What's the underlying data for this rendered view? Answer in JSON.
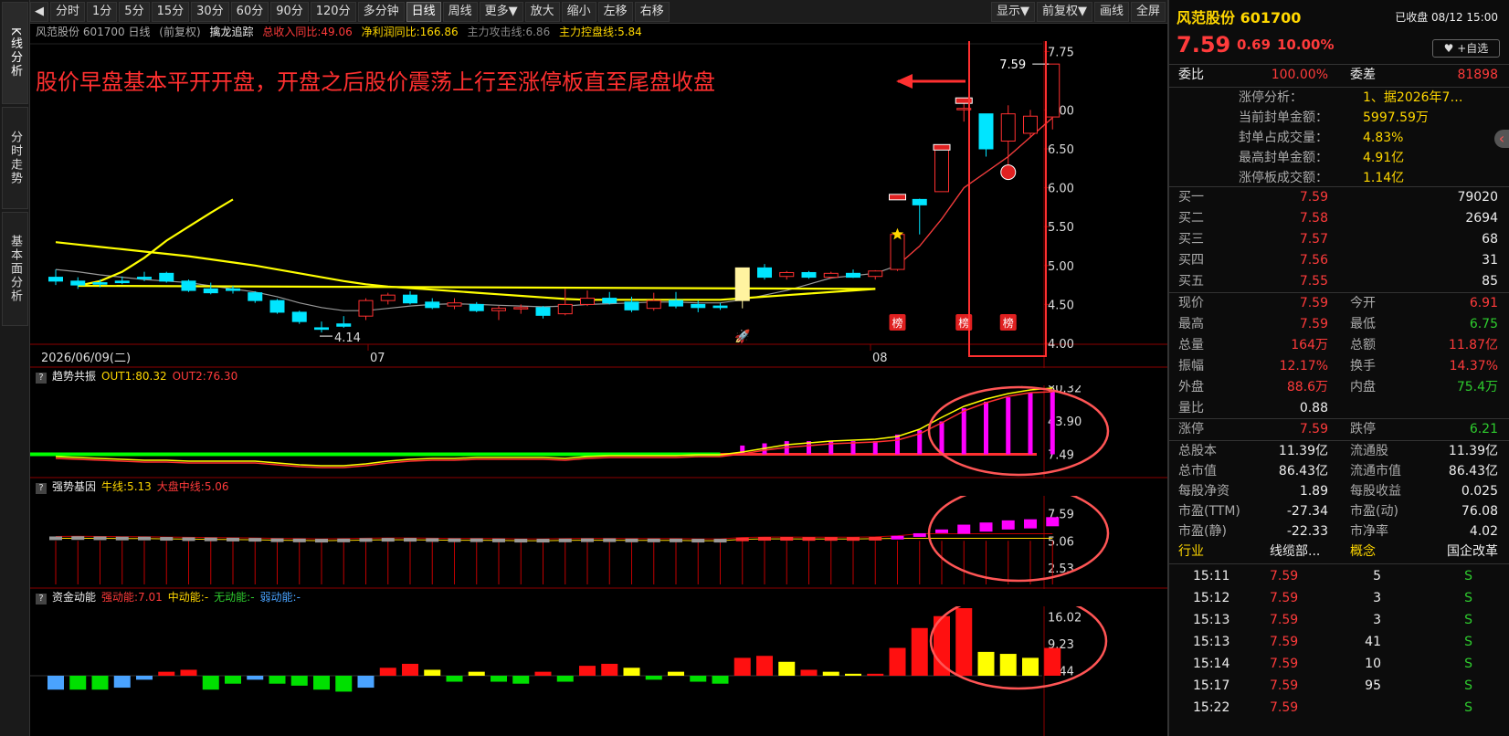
{
  "left_tabs": [
    "K线分析",
    "分时走势",
    "基本面分析"
  ],
  "toolbar": {
    "periods": [
      "分时",
      "1分",
      "5分",
      "15分",
      "30分",
      "60分",
      "90分",
      "120分",
      "多分钟",
      "日线",
      "周线",
      "更多▼",
      "放大",
      "缩小",
      "左移",
      "右移"
    ],
    "active": "日线",
    "right": [
      "显示▼",
      "前复权▼",
      "画线",
      "全屏"
    ]
  },
  "kline_header": {
    "name": "风范股份 601700 日线",
    "adj": "(前复权)",
    "indicator": "擒龙追踪",
    "rev": "总收入同比:49.06",
    "profit": "净利润同比:166.86",
    "attack": "主力攻击线:6.86",
    "control": "主力控盘线:5.84"
  },
  "annotation": "股价早盘基本平开开盘，开盘之后股价震荡上行至涨停板直至尾盘收盘",
  "price_axis": [
    "7.75",
    "7.00",
    "6.50",
    "6.00",
    "5.50",
    "5.00",
    "4.50",
    "4.00"
  ],
  "date_labels": [
    "2026/06/09(二)",
    "07",
    "08"
  ],
  "low_label": "4.14",
  "high_label": "7.59",
  "bang_label": "榜",
  "panel1": {
    "title": "趋势共振",
    "out1": "OUT1:80.32",
    "out2": "OUT2:76.30",
    "axis": [
      "80.32",
      "43.90",
      "7.49"
    ]
  },
  "panel2": {
    "title": "强势基因",
    "bull": "牛线:5.13",
    "mid": "大盘中线:5.06",
    "axis": [
      "7.59",
      "5.06",
      "2.53"
    ]
  },
  "panel3": {
    "title": "资金动能",
    "strong": "强动能:7.01",
    "medium": "中动能:-",
    "none": "无动能:-",
    "weak": "弱动能:-",
    "axis": [
      "16.02",
      "9.23",
      "2.44"
    ]
  },
  "colors": {
    "up": "#ff3030",
    "down": "#00e5ff",
    "ma_yellow": "#ffff00",
    "ma_grey": "#999999",
    "magenta": "#ff00ff",
    "green": "#00ff00"
  },
  "chart_data": {
    "type": "candlestick",
    "ylim": [
      4.0,
      7.85
    ],
    "candles": [
      [
        4.85,
        4.95,
        4.8,
        4.75
      ],
      [
        4.8,
        4.85,
        4.75,
        4.7
      ],
      [
        4.78,
        4.82,
        4.76,
        4.72
      ],
      [
        4.8,
        4.86,
        4.78,
        4.76
      ],
      [
        4.85,
        4.92,
        4.83,
        4.8
      ],
      [
        4.9,
        4.92,
        4.8,
        4.78
      ],
      [
        4.8,
        4.82,
        4.68,
        4.66
      ],
      [
        4.7,
        4.78,
        4.65,
        4.63
      ],
      [
        4.7,
        4.74,
        4.68,
        4.64
      ],
      [
        4.65,
        4.67,
        4.55,
        4.52
      ],
      [
        4.55,
        4.57,
        4.4,
        4.38
      ],
      [
        4.4,
        4.42,
        4.28,
        4.25
      ],
      [
        4.2,
        4.28,
        4.18,
        4.14
      ],
      [
        4.25,
        4.35,
        4.22,
        4.2
      ],
      [
        4.35,
        4.58,
        4.55,
        4.3
      ],
      [
        4.55,
        4.65,
        4.62,
        4.5
      ],
      [
        4.62,
        4.67,
        4.52,
        4.5
      ],
      [
        4.53,
        4.58,
        4.46,
        4.44
      ],
      [
        4.48,
        4.58,
        4.52,
        4.44
      ],
      [
        4.5,
        4.53,
        4.42,
        4.4
      ],
      [
        4.42,
        4.48,
        4.45,
        4.3
      ],
      [
        4.45,
        4.5,
        4.46,
        4.38
      ],
      [
        4.46,
        4.48,
        4.36,
        4.32
      ],
      [
        4.38,
        4.7,
        4.5,
        4.36
      ],
      [
        4.5,
        4.68,
        4.58,
        4.48
      ],
      [
        4.58,
        4.66,
        4.52,
        4.5
      ],
      [
        4.53,
        4.6,
        4.43,
        4.4
      ],
      [
        4.45,
        4.65,
        4.55,
        4.42
      ],
      [
        4.55,
        4.66,
        4.48,
        4.45
      ],
      [
        4.5,
        4.55,
        4.46,
        4.4
      ],
      [
        4.48,
        4.52,
        4.46,
        4.43
      ],
      [
        4.55,
        4.97,
        4.97,
        4.45
      ],
      [
        4.97,
        5.02,
        4.85,
        4.82
      ],
      [
        4.86,
        4.93,
        4.91,
        4.82
      ],
      [
        4.91,
        4.93,
        4.85,
        4.83
      ],
      [
        4.85,
        4.92,
        4.9,
        4.83
      ],
      [
        4.9,
        4.95,
        4.85,
        4.84
      ],
      [
        4.86,
        4.94,
        4.93,
        4.82
      ],
      [
        4.95,
        5.4,
        5.4,
        4.93
      ],
      [
        5.85,
        5.86,
        5.78,
        5.4
      ],
      [
        5.95,
        6.52,
        6.52,
        5.95
      ],
      [
        7.02,
        7.1,
        7.02,
        6.85
      ],
      [
        6.95,
        6.95,
        6.5,
        6.4
      ],
      [
        6.6,
        7.06,
        6.95,
        6.15
      ],
      [
        6.7,
        7.0,
        6.92,
        6.65
      ],
      [
        6.91,
        7.59,
        7.59,
        6.75
      ]
    ],
    "ma_yellow": [
      5.3,
      5.27,
      5.24,
      5.21,
      5.18,
      5.15,
      5.12,
      5.08,
      5.04,
      5.0,
      4.95,
      4.9,
      4.85,
      4.8,
      4.76,
      4.73,
      4.71,
      4.69,
      4.67,
      4.65,
      4.63,
      4.61,
      4.59,
      4.57,
      4.56,
      4.56,
      4.56,
      4.56,
      4.56,
      4.56,
      4.56,
      4.58,
      4.6,
      4.62,
      4.64,
      4.66,
      4.68,
      4.7,
      4.74,
      4.8,
      4.92,
      5.1,
      5.32,
      5.5,
      5.68,
      5.85
    ],
    "ma_grey": [
      4.95,
      4.92,
      4.88,
      4.85,
      4.82,
      4.8,
      4.78,
      4.74,
      4.7,
      4.66,
      4.6,
      4.52,
      4.46,
      4.42,
      4.42,
      4.45,
      4.48,
      4.5,
      4.51,
      4.5,
      4.49,
      4.48,
      4.47,
      4.48,
      4.5,
      4.51,
      4.52,
      4.53,
      4.53,
      4.52,
      4.52,
      4.56,
      4.62,
      4.68,
      4.76,
      4.84,
      4.87,
      4.9,
      5.0,
      5.25,
      5.6,
      6.0,
      6.2,
      6.4,
      6.65,
      6.9
    ],
    "p1_yellow": [
      5,
      4,
      3,
      2,
      1,
      1,
      0,
      0,
      0,
      0,
      -2,
      -4,
      -5,
      -5,
      -3,
      0,
      2,
      3,
      3,
      4,
      4,
      4,
      4,
      3,
      5,
      6,
      6,
      6,
      6,
      7,
      7,
      10,
      14,
      18,
      20,
      22,
      23,
      24,
      27,
      35,
      48,
      60,
      68,
      74,
      78,
      80
    ],
    "p1_red": [
      3,
      2,
      1,
      0,
      -1,
      -1,
      -2,
      -2,
      -2,
      -2,
      -4,
      -6,
      -7,
      -7,
      -5,
      -2,
      0,
      1,
      1,
      2,
      2,
      2,
      2,
      1,
      3,
      4,
      4,
      4,
      4,
      5,
      5,
      8,
      12,
      15,
      17,
      19,
      20,
      21,
      23,
      30,
      42,
      55,
      64,
      71,
      75,
      76
    ],
    "p1_bars": [
      0,
      0,
      0,
      0,
      0,
      0,
      0,
      0,
      0,
      0,
      0,
      0,
      0,
      0,
      0,
      0,
      0,
      0,
      0,
      0,
      0,
      0,
      0,
      0,
      0,
      0,
      0,
      0,
      0,
      0,
      0,
      8,
      10,
      12,
      12,
      12,
      12,
      12,
      18,
      22,
      30,
      42,
      48,
      52,
      56,
      58
    ],
    "p2_grey": [
      5.3,
      5.32,
      5.3,
      5.28,
      5.28,
      5.25,
      5.22,
      5.2,
      5.18,
      5.16,
      5.12,
      5.1,
      5.08,
      5.1,
      5.14,
      5.16,
      5.16,
      5.14,
      5.12,
      5.12,
      5.1,
      5.08,
      5.08,
      5.1,
      5.12,
      5.12,
      5.1,
      5.1,
      5.1,
      5.08,
      5.08,
      5.2,
      5.25,
      5.25,
      5.24,
      5.24,
      5.24,
      5.26,
      5.36,
      5.6,
      5.95,
      6.4,
      6.6,
      6.8,
      6.9,
      7.1
    ],
    "p3_bars": [
      [
        3.5,
        "blue"
      ],
      [
        3.5,
        "green"
      ],
      [
        3.5,
        "green"
      ],
      [
        3,
        "blue"
      ],
      [
        1,
        "blue"
      ],
      [
        1,
        "red"
      ],
      [
        1.5,
        "red"
      ],
      [
        3.5,
        "green"
      ],
      [
        2,
        "green"
      ],
      [
        1,
        "blue"
      ],
      [
        2,
        "green"
      ],
      [
        2.5,
        "green"
      ],
      [
        3.5,
        "green"
      ],
      [
        4,
        "green"
      ],
      [
        3,
        "blue"
      ],
      [
        2,
        "red"
      ],
      [
        3,
        "red"
      ],
      [
        1.5,
        "yellow"
      ],
      [
        1.5,
        "green"
      ],
      [
        1,
        "yellow"
      ],
      [
        1.5,
        "green"
      ],
      [
        2,
        "green"
      ],
      [
        1,
        "red"
      ],
      [
        1.5,
        "green"
      ],
      [
        2.5,
        "red"
      ],
      [
        3,
        "red"
      ],
      [
        2,
        "yellow"
      ],
      [
        1,
        "green"
      ],
      [
        1,
        "yellow"
      ],
      [
        1.5,
        "green"
      ],
      [
        2,
        "green"
      ],
      [
        4.5,
        "red"
      ],
      [
        5,
        "red"
      ],
      [
        3.5,
        "yellow"
      ],
      [
        1.5,
        "red"
      ],
      [
        1,
        "yellow"
      ],
      [
        0.5,
        "yellow"
      ],
      [
        0.5,
        "red"
      ],
      [
        7,
        "red"
      ],
      [
        12,
        "red"
      ],
      [
        15,
        "red"
      ],
      [
        17,
        "red"
      ],
      [
        6,
        "yellow"
      ],
      [
        5.5,
        "yellow"
      ],
      [
        4.5,
        "yellow"
      ],
      [
        7,
        "red"
      ]
    ]
  },
  "side": {
    "name": "风范股份 601700",
    "status": "已收盘 08/12 15:00",
    "price": "7.59",
    "change": "0.69",
    "pct": "10.00%",
    "fav": "♥ +自选",
    "ratio_label": "委比",
    "ratio": "100.00%",
    "diff_label": "委差",
    "diff": "81898",
    "zt": [
      [
        "涨停分析：",
        "1、据2026年7…"
      ],
      [
        "当前封单金额：",
        "5997.59万"
      ],
      [
        "封单占成交量：",
        "4.83%"
      ],
      [
        "最高封单金额：",
        "4.91亿"
      ],
      [
        "涨停板成交额：",
        "1.14亿"
      ]
    ],
    "bids": [
      [
        "买一",
        "7.59",
        "79020"
      ],
      [
        "买二",
        "7.58",
        "2694"
      ],
      [
        "买三",
        "7.57",
        "68"
      ],
      [
        "买四",
        "7.56",
        "31"
      ],
      [
        "买五",
        "7.55",
        "85"
      ]
    ],
    "quote": [
      [
        "现价",
        "7.59",
        "今开",
        "6.91"
      ],
      [
        "最高",
        "7.59",
        "最低",
        "6.75"
      ],
      [
        "总量",
        "164万",
        "总额",
        "11.87亿"
      ]
    ],
    "quote2": [
      [
        "振幅",
        "12.17%",
        "换手",
        "14.37%"
      ],
      [
        "外盘",
        "88.6万",
        "内盘",
        "75.4万"
      ],
      [
        "量比",
        "0.88",
        "",
        ""
      ]
    ],
    "limit": [
      "涨停",
      "7.59",
      "跌停",
      "6.21"
    ],
    "fund": [
      [
        "总股本",
        "11.39亿",
        "流通股",
        "11.39亿"
      ],
      [
        "总市值",
        "86.43亿",
        "流通市值",
        "86.43亿"
      ],
      [
        "每股净资",
        "1.89",
        "每股收益",
        "0.025"
      ],
      [
        "市盈(TTM)",
        "-27.34",
        "市盈(动)",
        "76.08"
      ],
      [
        "市盈(静)",
        "-22.33",
        "市净率",
        "4.02"
      ]
    ],
    "industry": [
      "行业",
      "线缆部...",
      "概念",
      "国企改革"
    ],
    "ticks": [
      [
        "15:11",
        "7.59",
        "5",
        "S"
      ],
      [
        "15:12",
        "7.59",
        "3",
        "S"
      ],
      [
        "15:13",
        "7.59",
        "3",
        "S"
      ],
      [
        "15:13",
        "7.59",
        "41",
        "S"
      ],
      [
        "15:14",
        "7.59",
        "10",
        "S"
      ],
      [
        "15:17",
        "7.59",
        "95",
        "S"
      ],
      [
        "15:22",
        "7.59",
        "",
        "S"
      ]
    ]
  }
}
